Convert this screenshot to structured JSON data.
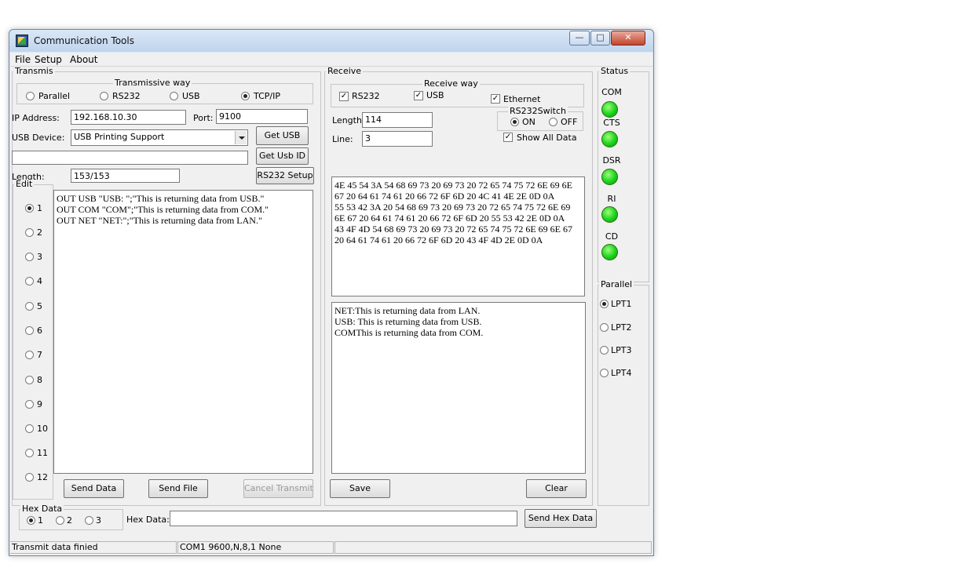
{
  "window": {
    "title": "Communication Tools",
    "icon": "app-icon"
  },
  "menu": [
    {
      "label": "File"
    },
    {
      "label": "Setup"
    },
    {
      "label": "About"
    }
  ],
  "transmit": {
    "group_label": "Transmis",
    "way_label": "Transmissive way",
    "way_options": [
      {
        "label": "Parallel",
        "selected": false
      },
      {
        "label": "RS232",
        "selected": false
      },
      {
        "label": "USB",
        "selected": false
      },
      {
        "label": "TCP/IP",
        "selected": true
      }
    ],
    "ip_label": "IP Address:",
    "ip_value": "192.168.10.30",
    "port_label": "Port:",
    "port_value": "9100",
    "usb_device_label": "USB Device:",
    "usb_device_value": "USB Printing Support",
    "get_usb_button": "Get USB",
    "usb_id_value": "",
    "get_usb_id_button": "Get Usb ID",
    "length_label": "Length:",
    "length_value": "153/153",
    "rs232_setup_button": "RS232 Setup",
    "edit_label": "Edit",
    "edit_options": [
      "1",
      "2",
      "3",
      "4",
      "5",
      "6",
      "7",
      "8",
      "9",
      "10",
      "11",
      "12"
    ],
    "edit_selected": "1",
    "edit_lines": [
      "OUT USB \"USB: \";\"This is returning data from USB.\"",
      "OUT COM \"COM\";\"This is returning data from COM.\"",
      "OUT NET \"NET:\";\"This is returning data from LAN.\""
    ],
    "send_data_button": "Send Data",
    "send_file_button": "Send File",
    "cancel_transmit_button": "Cancel Transmit"
  },
  "receive": {
    "group_label": "Receive",
    "way_label": "Receive way",
    "way_options": [
      {
        "label": "RS232",
        "checked": true
      },
      {
        "label": "USB",
        "checked": true
      },
      {
        "label": "Ethernet",
        "checked": true
      }
    ],
    "length_label": "Length:",
    "length_value": "114",
    "line_label": "Line:",
    "line_value": "3",
    "switch_label": "RS232Switch",
    "switch_on": "ON",
    "switch_off": "OFF",
    "switch_selected": "ON",
    "show_all_label": "Show All Data",
    "show_all_checked": true,
    "hex_lines": [
      "4E 45 54 3A 54 68 69 73 20 69 73 20 72 65 74 75 72 6E 69 6E",
      "67 20 64 61 74 61 20 66 72 6F 6D 20 4C 41 4E 2E 0D 0A",
      "55 53 42 3A 20 54 68 69 73 20 69 73 20 72 65 74 75 72 6E 69",
      "6E 67 20 64 61 74 61 20 66 72 6F 6D 20 55 53 42 2E 0D 0A",
      "43 4F 4D 54 68 69 73 20 69 73 20 72 65 74 75 72 6E 69 6E 67",
      "20 64 61 74 61 20 66 72 6F 6D 20 43 4F 4D 2E 0D 0A"
    ],
    "text_lines": [
      "NET:This is returning data from LAN.",
      "USB: This is returning data from USB.",
      "COMThis is returning data from COM."
    ],
    "save_button": "Save",
    "clear_button": "Clear"
  },
  "status": {
    "group_label": "Status",
    "leds": [
      {
        "label": "COM",
        "color": "#19d21b"
      },
      {
        "label": "CTS",
        "color": "#19d21b"
      },
      {
        "label": "DSR",
        "color": "#19d21b"
      },
      {
        "label": "RI",
        "color": "#19d21b"
      },
      {
        "label": "CD",
        "color": "#19d21b"
      }
    ]
  },
  "parallel": {
    "group_label": "Parallel",
    "options": [
      "LPT1",
      "LPT2",
      "LPT3",
      "LPT4"
    ],
    "selected": "LPT1"
  },
  "hex_data": {
    "group_label": "Hex Data",
    "options": [
      "1",
      "2",
      "3"
    ],
    "selected": "1",
    "field_label": "Hex Data:",
    "field_value": "",
    "send_button": "Send Hex Data"
  },
  "statusbar": {
    "message": "Transmit data finied",
    "port_info": "COM1 9600,N,8,1 None",
    "extra": ""
  }
}
